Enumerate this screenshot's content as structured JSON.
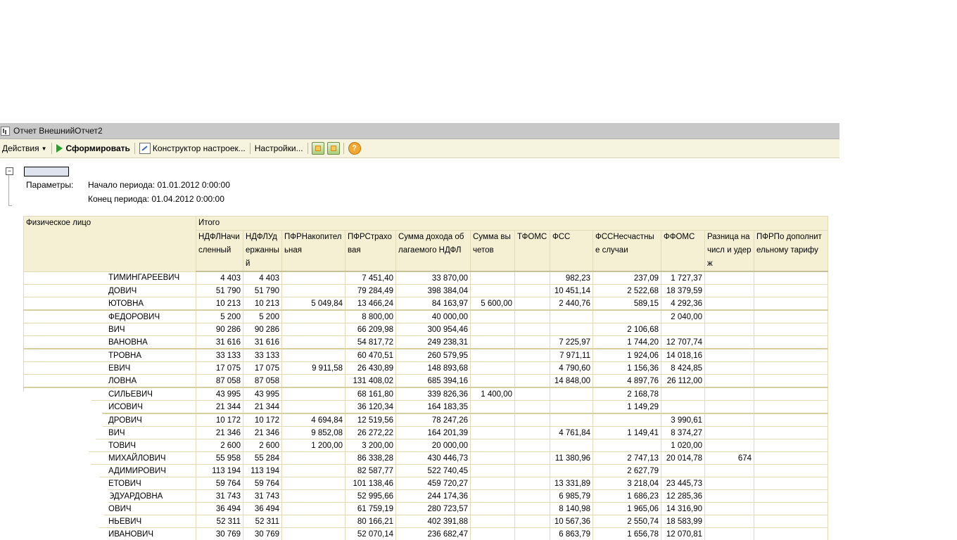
{
  "window": {
    "title": "Отчет  ВнешнийОтчет2"
  },
  "toolbar": {
    "actions": "Действия",
    "generate": "Сформировать",
    "constructor": "Конструктор настроек...",
    "settings": "Настройки...",
    "help": "?"
  },
  "params": {
    "label": "Параметры:",
    "start": "Начало периода: 01.01.2012 0:00:00",
    "end": "Конец периода: 01.04.2012 0:00:00"
  },
  "table": {
    "name_header": "Физическое лицо",
    "group_header": "Итого",
    "columns": [
      "НДФЛНачисленный",
      "НДФЛУдержанный",
      "ПФРНакопительная",
      "ПФРСтраховая",
      "Сумма дохода облагаемого НДФЛ",
      "Сумма вычетов",
      "ТФОМС",
      "ФСС",
      "ФССНесчастные случаи",
      "ФФОМС",
      "Разница начисл и удерж",
      "ПФРПо дополнительному тарифу"
    ],
    "rows": [
      {
        "name": "ТИМИНГАРЕЕВИЧ",
        "v": [
          "4 403",
          "4 403",
          "",
          "7 451,40",
          "33 870,00",
          "",
          "",
          "982,23",
          "237,09",
          "1 727,37",
          "",
          ""
        ]
      },
      {
        "name": "ДОВИЧ",
        "v": [
          "51 790",
          "51 790",
          "",
          "79 284,49",
          "398 384,04",
          "",
          "",
          "10 451,14",
          "2 522,68",
          "18 379,59",
          "",
          ""
        ]
      },
      {
        "name": "ЮТОВНА",
        "v": [
          "10 213",
          "10 213",
          "5 049,84",
          "13 466,24",
          "84 163,97",
          "5 600,00",
          "",
          "2 440,76",
          "589,15",
          "4 292,36",
          "",
          ""
        ]
      },
      {
        "name": "ФЕДОРОВИЧ",
        "v": [
          "5 200",
          "5 200",
          "",
          "8 800,00",
          "40 000,00",
          "",
          "",
          "",
          "",
          "2 040,00",
          "",
          ""
        ]
      },
      {
        "name": "ВИЧ",
        "v": [
          "90 286",
          "90 286",
          "",
          "66 209,98",
          "300 954,46",
          "",
          "",
          "",
          "2 106,68",
          "",
          "",
          ""
        ]
      },
      {
        "name": "ВАНОВНА",
        "v": [
          "31 616",
          "31 616",
          "",
          "54 817,72",
          "249 238,31",
          "",
          "",
          "7 225,97",
          "1 744,20",
          "12 707,74",
          "",
          ""
        ]
      },
      {
        "name": "ТРОВНА",
        "v": [
          "33 133",
          "33 133",
          "",
          "60 470,51",
          "260 579,95",
          "",
          "",
          "7 971,11",
          "1 924,06",
          "14 018,16",
          "",
          ""
        ]
      },
      {
        "name": "ЕВИЧ",
        "v": [
          "17 075",
          "17 075",
          "9 911,58",
          "26 430,89",
          "148 893,68",
          "",
          "",
          "4 790,60",
          "1 156,36",
          "8 424,85",
          "",
          ""
        ]
      },
      {
        "name": "ЛОВНА",
        "v": [
          "87 058",
          "87 058",
          "",
          "131 408,02",
          "685 394,16",
          "",
          "",
          "14 848,00",
          "4 897,76",
          "26 112,00",
          "",
          ""
        ]
      },
      {
        "name": "СИЛЬЕВИЧ",
        "v": [
          "43 995",
          "43 995",
          "",
          "68 161,80",
          "339 826,36",
          "1 400,00",
          "",
          "",
          "2 168,78",
          "",
          "",
          ""
        ]
      },
      {
        "name": "ИСОВИЧ",
        "v": [
          "21 344",
          "21 344",
          "",
          "36 120,34",
          "164 183,35",
          "",
          "",
          "",
          "1 149,29",
          "",
          "",
          ""
        ]
      },
      {
        "name": "ДРОВИЧ",
        "v": [
          "10 172",
          "10 172",
          "4 694,84",
          "12 519,56",
          "78 247,26",
          "",
          "",
          "",
          "",
          "3 990,61",
          "",
          ""
        ]
      },
      {
        "name": "ВИЧ",
        "v": [
          "21 346",
          "21 346",
          "9 852,08",
          "26 272,22",
          "164 201,39",
          "",
          "",
          "4 761,84",
          "1 149,41",
          "8 374,27",
          "",
          ""
        ]
      },
      {
        "name": "ТОВИЧ",
        "v": [
          "2 600",
          "2 600",
          "1 200,00",
          "3 200,00",
          "20 000,00",
          "",
          "",
          "",
          "",
          "1 020,00",
          "",
          ""
        ]
      },
      {
        "name": "МИХАЙЛОВИЧ",
        "v": [
          "55 958",
          "55 284",
          "",
          "86 338,28",
          "430 446,73",
          "",
          "",
          "11 380,96",
          "2 747,13",
          "20 014,78",
          "674",
          ""
        ]
      },
      {
        "name": "АДИМИРОВИЧ",
        "v": [
          "113 194",
          "113 194",
          "",
          "82 587,77",
          "522 740,45",
          "",
          "",
          "",
          "2 627,79",
          "",
          "",
          ""
        ]
      },
      {
        "name": "ЕТОВИЧ",
        "v": [
          "59 764",
          "59 764",
          "",
          "101 138,46",
          "459 720,27",
          "",
          "",
          "13 331,89",
          "3 218,04",
          "23 445,73",
          "",
          ""
        ]
      },
      {
        "name": "ЭДУАРДОВНА",
        "v": [
          "31 743",
          "31 743",
          "",
          "52 995,66",
          "244 174,36",
          "",
          "",
          "6 985,79",
          "1 686,23",
          "12 285,36",
          "",
          ""
        ]
      },
      {
        "name": "ОВИЧ",
        "v": [
          "36 494",
          "36 494",
          "",
          "61 759,19",
          "280 723,57",
          "",
          "",
          "8 140,98",
          "1 965,06",
          "14 316,90",
          "",
          ""
        ]
      },
      {
        "name": "НЬЕВИЧ",
        "v": [
          "52 311",
          "52 311",
          "",
          "80 166,21",
          "402 391,88",
          "",
          "",
          "10 567,36",
          "2 550,74",
          "18 583,99",
          "",
          ""
        ]
      },
      {
        "name": "ИВАНОВИЧ",
        "v": [
          "30 769",
          "30 769",
          "",
          "52 070,14",
          "236 682,47",
          "",
          "",
          "6 863,79",
          "1 656,78",
          "12 070,81",
          "",
          ""
        ]
      }
    ]
  }
}
